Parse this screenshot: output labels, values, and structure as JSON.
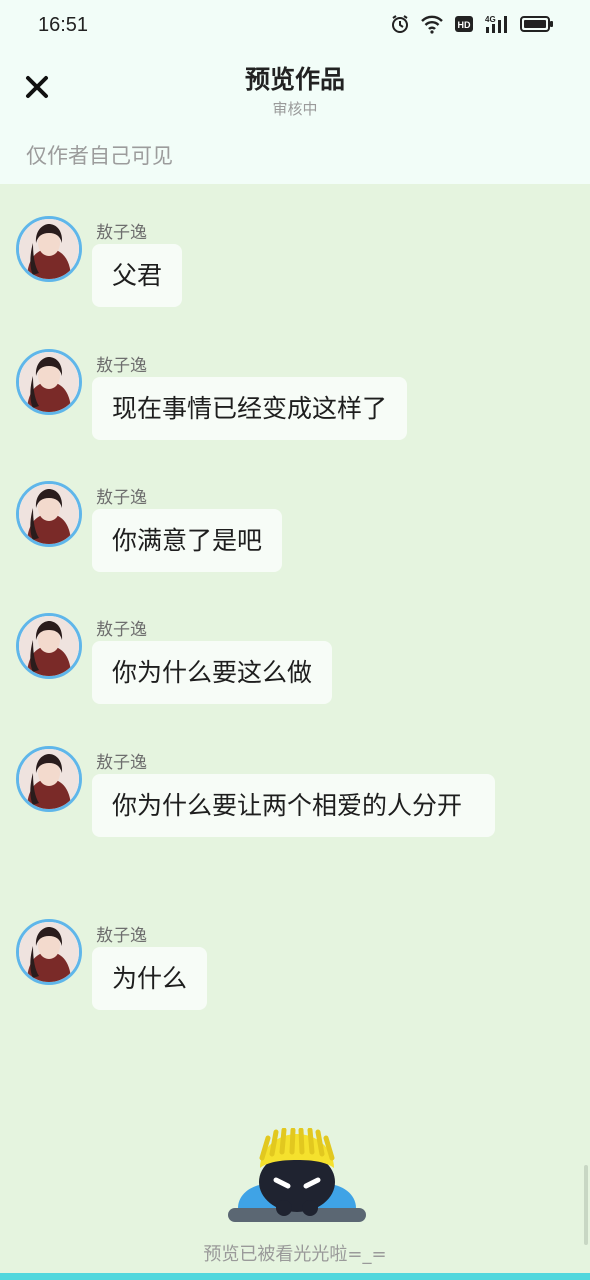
{
  "status_bar": {
    "time": "16:51",
    "icons": [
      "alarm-icon",
      "wifi-icon",
      "hd-icon",
      "4g-signal-icon",
      "battery-icon"
    ],
    "hd_label": "HD",
    "network_label": "4G"
  },
  "header": {
    "close_icon": "close-icon",
    "title": "预览作品",
    "subtitle": "审核中",
    "visibility_note": "仅作者自己可见"
  },
  "messages": [
    {
      "sender": "敖子逸",
      "text": "父君"
    },
    {
      "sender": "敖子逸",
      "text": "现在事情已经变成这样了"
    },
    {
      "sender": "敖子逸",
      "text": "你满意了是吧"
    },
    {
      "sender": "敖子逸",
      "text": "你为什么要这么做"
    },
    {
      "sender": "敖子逸",
      "text": "你为什么要让两个相爱的人分开"
    },
    {
      "sender": "敖子逸",
      "text": "为什么"
    }
  ],
  "footer": {
    "mascot_icon": "mascot-icon",
    "text": "预览已被看光光啦=_="
  },
  "colors": {
    "background": "#e5f4df",
    "header_background": "#f2fdf8",
    "bubble": "#f7fcf7",
    "avatar_border": "#5fb6ea",
    "bottom_strip": "#51d7dd"
  }
}
